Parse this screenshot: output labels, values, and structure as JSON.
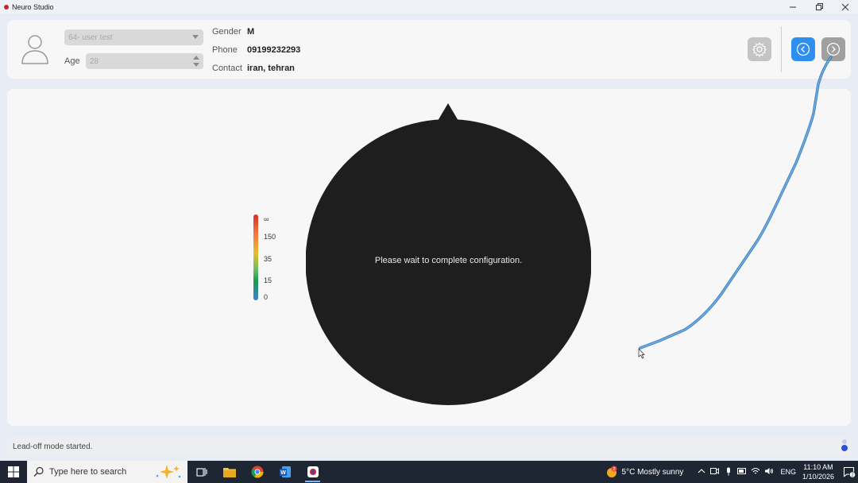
{
  "window": {
    "title": "Neuro Studio"
  },
  "patient": {
    "user_select_value": "64- user test",
    "age_label": "Age",
    "age_value": "28",
    "gender_label": "Gender",
    "gender_value": "M",
    "phone_label": "Phone",
    "phone_value": "09199232293",
    "contact_label": "Contact",
    "contact_value": "iran, tehran"
  },
  "legend": {
    "labels": [
      "∞",
      "150",
      "35",
      "15",
      "0"
    ],
    "colors": [
      "#d73027",
      "#f46d43",
      "#e6c02a",
      "#66bd63",
      "#1a9850",
      "#3b82d6"
    ]
  },
  "main": {
    "message": "Please wait to complete configuration."
  },
  "status": {
    "text": "Lead-off mode started."
  },
  "taskbar": {
    "search_placeholder": "Type here to search",
    "weather": "5°C  Mostly sunny",
    "weather_badge": "2",
    "language": "ENG",
    "time": "11:10 AM",
    "date": "1/10/2026",
    "notifications": "2"
  },
  "colors": {
    "accent": "#2e8ff0",
    "head": "#1e1e1e",
    "curve": "#2f7bc2"
  }
}
